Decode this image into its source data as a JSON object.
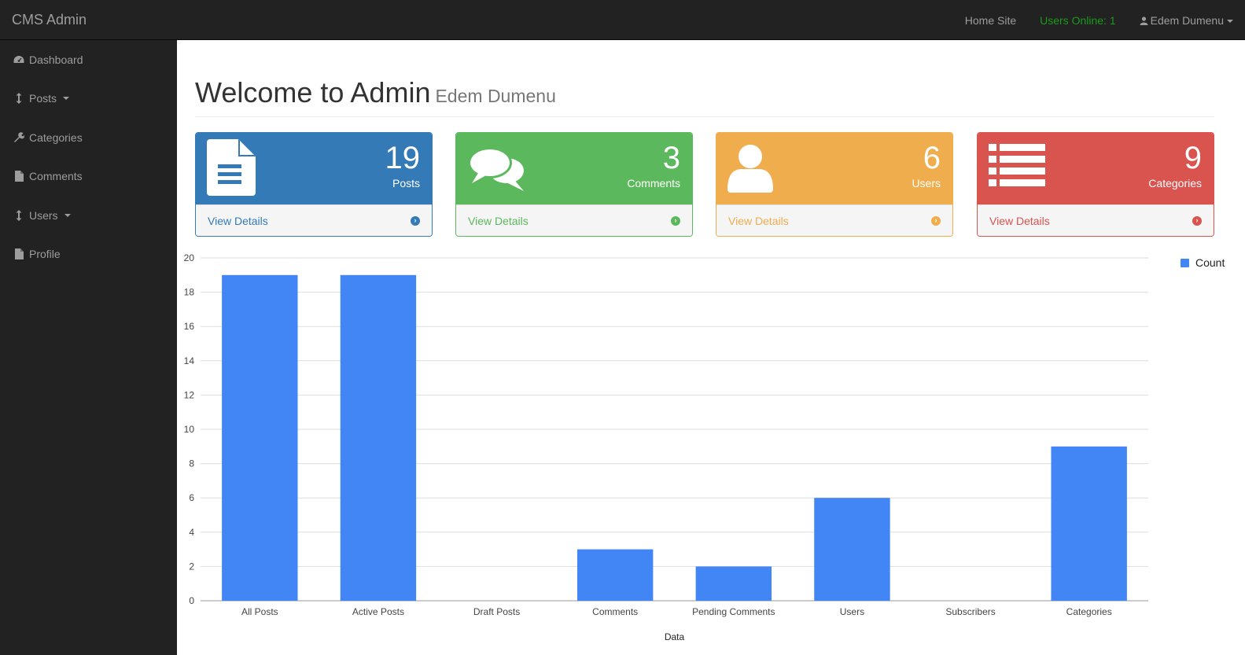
{
  "topbar": {
    "brand": "CMS Admin",
    "home_site": "Home Site",
    "users_online": "Users Online: 1",
    "user_name": "Edem Dumenu"
  },
  "sidebar": {
    "items": [
      {
        "label": "Dashboard",
        "icon": "dashboard-icon"
      },
      {
        "label": "Posts",
        "icon": "arrows-v-icon",
        "has_caret": true
      },
      {
        "label": "Categories",
        "icon": "wrench-icon"
      },
      {
        "label": "Comments",
        "icon": "file-icon"
      },
      {
        "label": "Users",
        "icon": "arrows-v-icon",
        "has_caret": true
      },
      {
        "label": "Profile",
        "icon": "file-icon"
      }
    ]
  },
  "header": {
    "title": "Welcome to Admin",
    "subtitle": "Edem Dumenu"
  },
  "panels": [
    {
      "count": "19",
      "label": "Posts",
      "link": "View Details",
      "color": "#337ab7",
      "icon": "file-text-icon"
    },
    {
      "count": "3",
      "label": "Comments",
      "link": "View Details",
      "color": "#5cb85c",
      "icon": "comments-icon"
    },
    {
      "count": "6",
      "label": "Users",
      "link": "View Details",
      "color": "#f0ad4e",
      "icon": "user-icon"
    },
    {
      "count": "9",
      "label": "Categories",
      "link": "View Details",
      "color": "#d9534f",
      "icon": "list-icon"
    }
  ],
  "chart_data": {
    "type": "bar",
    "categories": [
      "All Posts",
      "Active Posts",
      "Draft Posts",
      "Comments",
      "Pending Comments",
      "Users",
      "Subscribers",
      "Categories"
    ],
    "series": [
      {
        "name": "Count",
        "values": [
          19,
          19,
          0,
          3,
          2,
          6,
          0,
          9
        ],
        "color": "#4285f4"
      }
    ],
    "xlabel": "Data",
    "ylabel": "",
    "ylim": [
      0,
      20
    ],
    "yticks": [
      0,
      2,
      4,
      6,
      8,
      10,
      12,
      14,
      16,
      18,
      20
    ],
    "grid": true,
    "legend": "top-right"
  }
}
